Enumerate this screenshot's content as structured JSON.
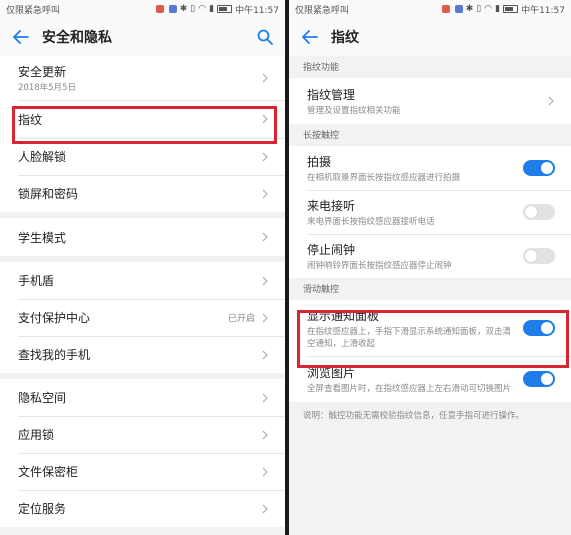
{
  "left": {
    "status_bar": {
      "carrier": "仅限紧急呼叫",
      "time": "中午11:57"
    },
    "title": "安全和隐私",
    "rows": [
      {
        "label": "安全更新",
        "sub": "2018年5月5日"
      },
      {
        "label": "指纹"
      },
      {
        "label": "人脸解锁"
      },
      {
        "label": "锁屏和密码"
      },
      {
        "label": "学生模式"
      },
      {
        "label": "手机盾"
      },
      {
        "label": "支付保护中心",
        "status": "已开启"
      },
      {
        "label": "查找我的手机"
      },
      {
        "label": "隐私空间"
      },
      {
        "label": "应用锁"
      },
      {
        "label": "文件保密柜"
      },
      {
        "label": "定位服务"
      }
    ]
  },
  "right": {
    "status_bar": {
      "carrier": "仅限紧急呼叫",
      "time": "中午11:57"
    },
    "title": "指纹",
    "sections": {
      "function": "指纹功能",
      "long_press": "长按触控",
      "slide": "滑动触控"
    },
    "manage": {
      "label": "指纹管理",
      "sub": "管理及设置指纹相关功能"
    },
    "toggles": [
      {
        "label": "拍摄",
        "sub": "在相机取景界面长按指纹感应器进行拍摄",
        "on": true
      },
      {
        "label": "来电接听",
        "sub": "来电界面长按指纹感应器接听电话",
        "on": false
      },
      {
        "label": "停止闹钟",
        "sub": "闹钟响铃界面长按指纹感应器停止闹钟",
        "on": false
      },
      {
        "label": "显示通知面板",
        "sub": "在指纹感应器上，手指下滑显示系统通知面板，双击清空通知，上滑收起",
        "on": true
      },
      {
        "label": "浏览图片",
        "sub": "全屏查看图片时，在指纹感应器上左右滑动可切换图片",
        "on": true
      }
    ],
    "note": "说明：触控功能无需校验指纹信息，任意手指可进行操作。"
  },
  "colors": {
    "accent": "#1e7de8",
    "highlight": "#d7262f",
    "background": "#f2f2f2"
  }
}
